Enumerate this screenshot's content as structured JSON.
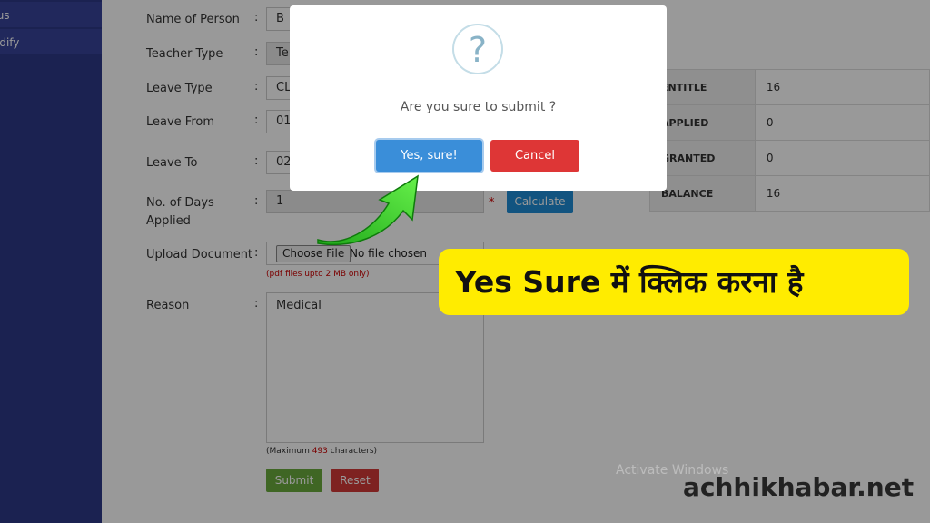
{
  "sidebar": {
    "items": [
      {
        "label": "tus"
      },
      {
        "label": "odify"
      }
    ]
  },
  "form": {
    "name_label": "Name of Person",
    "name_value": "B",
    "teacher_type_label": "Teacher Type",
    "teacher_type_value": "Te",
    "leave_type_label": "Leave Type",
    "leave_type_value": "CL",
    "leave_from_label": "Leave From",
    "leave_from_value": "01",
    "leave_to_label": "Leave To",
    "leave_to_value": "02",
    "days_label_1": "No. of Days",
    "days_label_2": "Applied",
    "days_value": "1",
    "required_mark": "*",
    "calculate_label": "Calculate",
    "upload_label": "Upload Document",
    "choose_file_label": "Choose File",
    "no_file_text": "No file chosen",
    "upload_hint": "(pdf files upto 2 MB only)",
    "reason_label": "Reason",
    "reason_value": "Medical",
    "max_chars_prefix": "(Maximum ",
    "max_chars_num": "493",
    "max_chars_suffix": " characters)",
    "submit_label": "Submit",
    "reset_label": "Reset",
    "colon": ":"
  },
  "summary": {
    "rows": [
      {
        "key": "ENTITLE",
        "value": "16"
      },
      {
        "key": "APPLIED",
        "value": "0"
      },
      {
        "key": "GRANTED",
        "value": "0"
      },
      {
        "key": "BALANCE",
        "value": "16"
      }
    ]
  },
  "modal": {
    "icon": "question-icon",
    "icon_glyph": "?",
    "message": "Are you sure to submit ?",
    "confirm_label": "Yes, sure!",
    "cancel_label": "Cancel"
  },
  "annotation": {
    "callout_text": "Yes Sure में क्लिक करना है",
    "arrow_color": "#3ddc2e",
    "callout_color": "#ffec00"
  },
  "watermark": {
    "text": "Activate Windows"
  },
  "site": {
    "name": "achhikhabar.net"
  }
}
